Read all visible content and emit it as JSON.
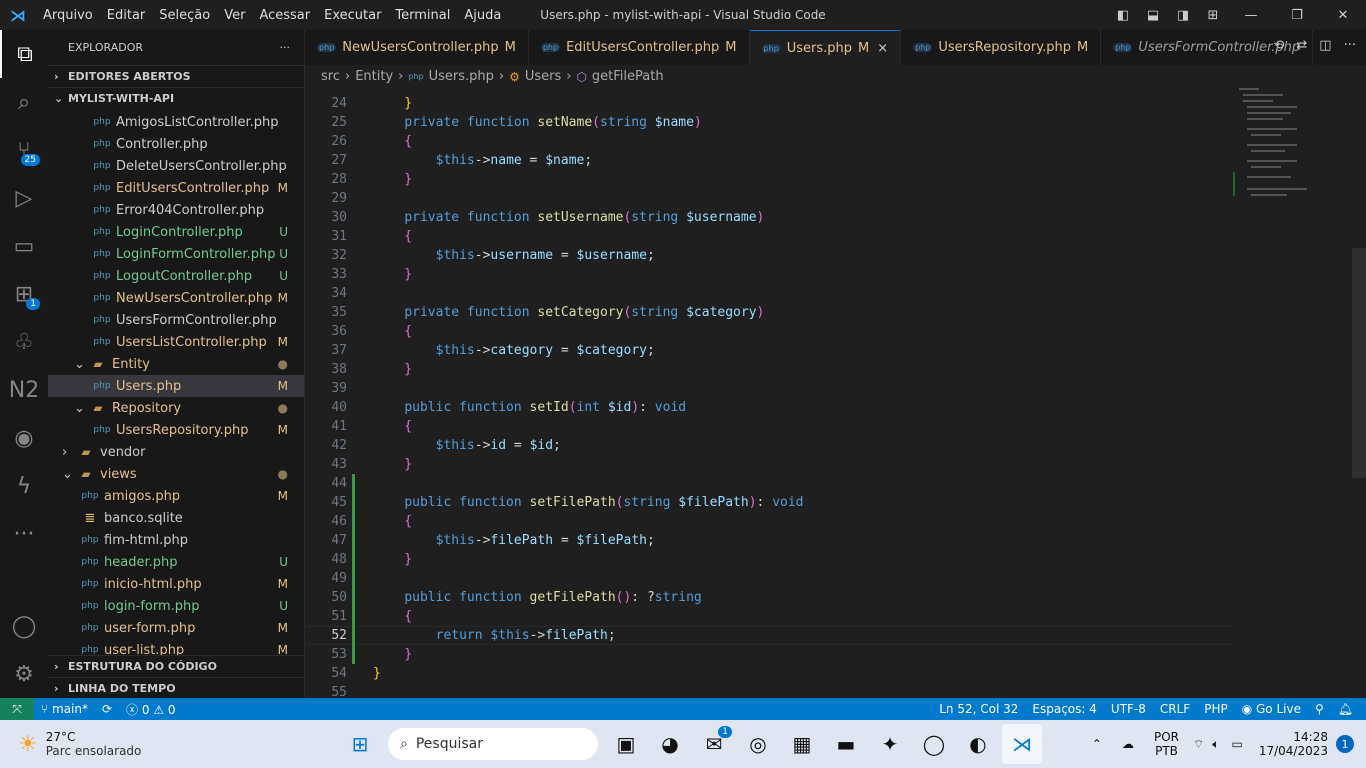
{
  "titlebar": {
    "menus": [
      "Arquivo",
      "Editar",
      "Seleção",
      "Ver",
      "Acessar",
      "Executar",
      "Terminal",
      "Ajuda"
    ],
    "title": "Users.php - mylist-with-api - Visual Studio Code"
  },
  "activity": {
    "items": [
      {
        "name": "explorer-icon",
        "glyph": "⧉"
      },
      {
        "name": "search-icon",
        "glyph": "⌕"
      },
      {
        "name": "source-control-icon",
        "glyph": "⑂",
        "badge": "25"
      },
      {
        "name": "run-debug-icon",
        "glyph": "▷"
      },
      {
        "name": "remote-explorer-icon",
        "glyph": "▭"
      },
      {
        "name": "extensions-icon",
        "glyph": "⊞",
        "badge": "1"
      },
      {
        "name": "tree-icon",
        "glyph": "♧"
      },
      {
        "name": "n2-icon",
        "glyph": "N2"
      },
      {
        "name": "github-icon",
        "glyph": "◉"
      },
      {
        "name": "thunder-icon",
        "glyph": "ϟ"
      },
      {
        "name": "more-icon",
        "glyph": "···"
      }
    ],
    "bottom": [
      {
        "name": "account-icon",
        "glyph": "◯"
      },
      {
        "name": "settings-gear-icon",
        "glyph": "⚙"
      }
    ]
  },
  "sidebar": {
    "title": "EXPLORADOR",
    "more": "···",
    "open_editors": "EDITORES ABERTOS",
    "project": "MYLIST-WITH-API",
    "tree": [
      {
        "label": "AmigosListController.php",
        "indent": 2,
        "type": "php",
        "status": "",
        "color": "#cccccc"
      },
      {
        "label": "Controller.php",
        "indent": 2,
        "type": "php",
        "status": "",
        "color": "#cccccc"
      },
      {
        "label": "DeleteUsersController.php",
        "indent": 2,
        "type": "php",
        "status": "",
        "color": "#cccccc"
      },
      {
        "label": "EditUsersController.php",
        "indent": 2,
        "type": "php",
        "status": "M",
        "color": "#e2c08d"
      },
      {
        "label": "Error404Controller.php",
        "indent": 2,
        "type": "php",
        "status": "",
        "color": "#cccccc"
      },
      {
        "label": "LoginController.php",
        "indent": 2,
        "type": "php",
        "status": "U",
        "color": "#73c991"
      },
      {
        "label": "LoginFormController.php",
        "indent": 2,
        "type": "php",
        "status": "U",
        "color": "#73c991"
      },
      {
        "label": "LogoutController.php",
        "indent": 2,
        "type": "php",
        "status": "U",
        "color": "#73c991"
      },
      {
        "label": "NewUsersController.php",
        "indent": 2,
        "type": "php",
        "status": "M",
        "color": "#e2c08d"
      },
      {
        "label": "UsersFormController.php",
        "indent": 2,
        "type": "php",
        "status": "",
        "color": "#cccccc"
      },
      {
        "label": "UsersListController.php",
        "indent": 2,
        "type": "php",
        "status": "M",
        "color": "#e2c08d"
      },
      {
        "label": "Entity",
        "indent": 1,
        "type": "folder-open",
        "status": "●",
        "color": "#e2c08d"
      },
      {
        "label": "Users.php",
        "indent": 2,
        "type": "php",
        "status": "M",
        "color": "#e2c08d",
        "selected": true
      },
      {
        "label": "Repository",
        "indent": 1,
        "type": "folder-open",
        "status": "●",
        "color": "#e2c08d"
      },
      {
        "label": "UsersRepository.php",
        "indent": 2,
        "type": "php",
        "status": "M",
        "color": "#e2c08d"
      },
      {
        "label": "vendor",
        "indent": 0,
        "type": "folder",
        "status": "",
        "color": "#cccccc"
      },
      {
        "label": "views",
        "indent": 0,
        "type": "folder-open",
        "status": "●",
        "color": "#e2c08d"
      },
      {
        "label": "amigos.php",
        "indent": 1,
        "type": "php",
        "status": "M",
        "color": "#e2c08d"
      },
      {
        "label": "banco.sqlite",
        "indent": 1,
        "type": "db",
        "status": "",
        "color": "#cccccc"
      },
      {
        "label": "fim-html.php",
        "indent": 1,
        "type": "php",
        "status": "",
        "color": "#cccccc"
      },
      {
        "label": "header.php",
        "indent": 1,
        "type": "php",
        "status": "U",
        "color": "#73c991"
      },
      {
        "label": "inicio-html.php",
        "indent": 1,
        "type": "php",
        "status": "M",
        "color": "#e2c08d"
      },
      {
        "label": "login-form.php",
        "indent": 1,
        "type": "php",
        "status": "U",
        "color": "#73c991"
      },
      {
        "label": "user-form.php",
        "indent": 1,
        "type": "php",
        "status": "M",
        "color": "#e2c08d"
      },
      {
        "label": "user-list.php",
        "indent": 1,
        "type": "php",
        "status": "M",
        "color": "#e2c08d"
      }
    ],
    "outline": "ESTRUTURA DO CÓDIGO",
    "timeline": "LINHA DO TEMPO"
  },
  "tabs": [
    {
      "label": "NewUsersController.php",
      "status": "M"
    },
    {
      "label": "EditUsersController.php",
      "status": "M"
    },
    {
      "label": "Users.php",
      "status": "M",
      "active": true,
      "close": "×"
    },
    {
      "label": "UsersRepository.php",
      "status": "M"
    },
    {
      "label": "UsersFormController.php",
      "status": "",
      "italic": true
    }
  ],
  "breadcrumb": [
    "src",
    "Entity",
    "Users.php",
    "Users",
    "getFilePath"
  ],
  "code": {
    "current_line": 52,
    "modified_lines": [
      44,
      45,
      46,
      47,
      48,
      49,
      50,
      51,
      52,
      53
    ],
    "lines": [
      {
        "n": 24,
        "t": [
          [
            "y",
            "    }"
          ]
        ]
      },
      {
        "n": 25,
        "t": [
          [
            "t",
            "    "
          ],
          [
            "k",
            "private function "
          ],
          [
            "f",
            "setName"
          ],
          [
            "p",
            "("
          ],
          [
            "k",
            "string "
          ],
          [
            "v",
            "$name"
          ],
          [
            "p",
            ")"
          ]
        ]
      },
      {
        "n": 26,
        "t": [
          [
            "p",
            "    {"
          ]
        ]
      },
      {
        "n": 27,
        "t": [
          [
            "t",
            "        "
          ],
          [
            "k",
            "$this"
          ],
          [
            "t",
            "->"
          ],
          [
            "v",
            "name"
          ],
          [
            "t",
            " = "
          ],
          [
            "v",
            "$name"
          ],
          [
            "t",
            ";"
          ]
        ]
      },
      {
        "n": 28,
        "t": [
          [
            "p",
            "    }"
          ]
        ]
      },
      {
        "n": 29,
        "t": []
      },
      {
        "n": 30,
        "t": [
          [
            "t",
            "    "
          ],
          [
            "k",
            "private function "
          ],
          [
            "f",
            "setUsername"
          ],
          [
            "p",
            "("
          ],
          [
            "k",
            "string "
          ],
          [
            "v",
            "$username"
          ],
          [
            "p",
            ")"
          ]
        ]
      },
      {
        "n": 31,
        "t": [
          [
            "p",
            "    {"
          ]
        ]
      },
      {
        "n": 32,
        "t": [
          [
            "t",
            "        "
          ],
          [
            "k",
            "$this"
          ],
          [
            "t",
            "->"
          ],
          [
            "v",
            "username"
          ],
          [
            "t",
            " = "
          ],
          [
            "v",
            "$username"
          ],
          [
            "t",
            ";"
          ]
        ]
      },
      {
        "n": 33,
        "t": [
          [
            "p",
            "    }"
          ]
        ]
      },
      {
        "n": 34,
        "t": []
      },
      {
        "n": 35,
        "t": [
          [
            "t",
            "    "
          ],
          [
            "k",
            "private function "
          ],
          [
            "f",
            "setCategory"
          ],
          [
            "p",
            "("
          ],
          [
            "k",
            "string "
          ],
          [
            "v",
            "$category"
          ],
          [
            "p",
            ")"
          ]
        ]
      },
      {
        "n": 36,
        "t": [
          [
            "p",
            "    {"
          ]
        ]
      },
      {
        "n": 37,
        "t": [
          [
            "t",
            "        "
          ],
          [
            "k",
            "$this"
          ],
          [
            "t",
            "->"
          ],
          [
            "v",
            "category"
          ],
          [
            "t",
            " = "
          ],
          [
            "v",
            "$category"
          ],
          [
            "t",
            ";"
          ]
        ]
      },
      {
        "n": 38,
        "t": [
          [
            "p",
            "    }"
          ]
        ]
      },
      {
        "n": 39,
        "t": []
      },
      {
        "n": 40,
        "t": [
          [
            "t",
            "    "
          ],
          [
            "k",
            "public function "
          ],
          [
            "f",
            "setId"
          ],
          [
            "p",
            "("
          ],
          [
            "k",
            "int "
          ],
          [
            "v",
            "$id"
          ],
          [
            "p",
            ")"
          ],
          [
            "t",
            ": "
          ],
          [
            "k",
            "void"
          ]
        ]
      },
      {
        "n": 41,
        "t": [
          [
            "p",
            "    {"
          ]
        ]
      },
      {
        "n": 42,
        "t": [
          [
            "t",
            "        "
          ],
          [
            "k",
            "$this"
          ],
          [
            "t",
            "->"
          ],
          [
            "v",
            "id"
          ],
          [
            "t",
            " = "
          ],
          [
            "v",
            "$id"
          ],
          [
            "t",
            ";"
          ]
        ]
      },
      {
        "n": 43,
        "t": [
          [
            "p",
            "    }"
          ]
        ]
      },
      {
        "n": 44,
        "t": []
      },
      {
        "n": 45,
        "t": [
          [
            "t",
            "    "
          ],
          [
            "k",
            "public function "
          ],
          [
            "f",
            "setFilePath"
          ],
          [
            "p",
            "("
          ],
          [
            "k",
            "string "
          ],
          [
            "v",
            "$filePath"
          ],
          [
            "p",
            ")"
          ],
          [
            "t",
            ": "
          ],
          [
            "k",
            "void"
          ]
        ]
      },
      {
        "n": 46,
        "t": [
          [
            "p",
            "    {"
          ]
        ]
      },
      {
        "n": 47,
        "t": [
          [
            "t",
            "        "
          ],
          [
            "k",
            "$this"
          ],
          [
            "t",
            "->"
          ],
          [
            "v",
            "filePath"
          ],
          [
            "t",
            " = "
          ],
          [
            "v",
            "$filePath"
          ],
          [
            "t",
            ";"
          ]
        ]
      },
      {
        "n": 48,
        "t": [
          [
            "p",
            "    }"
          ]
        ]
      },
      {
        "n": 49,
        "t": []
      },
      {
        "n": 50,
        "t": [
          [
            "t",
            "    "
          ],
          [
            "k",
            "public function "
          ],
          [
            "f",
            "getFilePath"
          ],
          [
            "p",
            "()"
          ],
          [
            "t",
            ": ?"
          ],
          [
            "k",
            "string"
          ]
        ]
      },
      {
        "n": 51,
        "t": [
          [
            "p",
            "    {"
          ]
        ]
      },
      {
        "n": 52,
        "t": [
          [
            "t",
            "        "
          ],
          [
            "k",
            "return "
          ],
          [
            "k",
            "$this"
          ],
          [
            "t",
            "->"
          ],
          [
            "v",
            "filePath"
          ],
          [
            "t",
            ";"
          ]
        ]
      },
      {
        "n": 53,
        "t": [
          [
            "p",
            "    }"
          ]
        ]
      },
      {
        "n": 54,
        "t": [
          [
            "y",
            "}"
          ]
        ]
      },
      {
        "n": 55,
        "t": []
      }
    ]
  },
  "status": {
    "branch": "main*",
    "errors": "0",
    "warnings": "0",
    "position": "Ln 52, Col 32",
    "spaces": "Espaços: 4",
    "encoding": "UTF-8",
    "eol": "CRLF",
    "language": "PHP",
    "golive": "Go Live"
  },
  "taskbar": {
    "weather_temp": "27°C",
    "weather_desc": "Parc ensolarado",
    "search": "Pesquisar",
    "lang1": "POR",
    "lang2": "PTB",
    "time": "14:28",
    "date": "17/04/2023",
    "notif": "1",
    "apps": [
      {
        "name": "task-view-icon",
        "g": "▣"
      },
      {
        "name": "chat-icon",
        "g": "◕"
      },
      {
        "name": "mail-icon",
        "g": "✉",
        "badge": "1"
      },
      {
        "name": "chrome-icon",
        "g": "◎"
      },
      {
        "name": "store-icon",
        "g": "▦"
      },
      {
        "name": "file-explorer-icon",
        "g": "▬"
      },
      {
        "name": "copilot-icon",
        "g": "✦"
      },
      {
        "name": "dell-icon",
        "g": "◯"
      },
      {
        "name": "edge-icon",
        "g": "◐"
      },
      {
        "name": "vscode-icon",
        "g": "⋊"
      }
    ]
  },
  "colors": {
    "accent": "#007acc",
    "modified": "#e2c08d",
    "untracked": "#73c991",
    "gutter_added": "#2ea043"
  }
}
